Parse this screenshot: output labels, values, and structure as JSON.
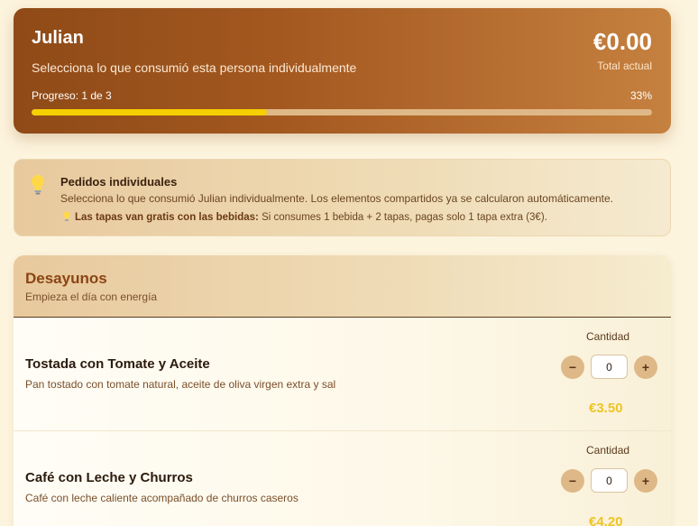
{
  "header": {
    "name": "Julian",
    "subtitle": "Selecciona lo que consumió esta persona individualmente",
    "total": "€0.00",
    "total_label": "Total actual",
    "progress_label": "Progreso: 1 de 3",
    "progress_percent_text": "33%",
    "progress_fraction": 0.38
  },
  "info": {
    "icon": "lightbulb-icon",
    "title": "Pedidos individuales",
    "description": "Selecciona lo que consumió Julian individualmente. Los elementos compartidos ya se calcularon automáticamente.",
    "tip_bold": "Las tapas van gratis con las bebidas:",
    "tip_text": " Si consumes 1 bebida + 2 tapas, pagas solo 1 tapa extra (3€)."
  },
  "section": {
    "title": "Desayunos",
    "subtitle": "Empieza el día con energía",
    "items": [
      {
        "name": "Tostada con Tomate y Aceite",
        "description": "Pan tostado con tomate natural, aceite de oliva virgen extra y sal",
        "quantity_label": "Cantidad",
        "quantity": "0",
        "price": "€3.50",
        "minus": "−",
        "plus": "+"
      },
      {
        "name": "Café con Leche y Churros",
        "description": "Café con leche caliente acompañado de churros caseros",
        "quantity_label": "Cantidad",
        "quantity": "0",
        "price": "€4.20",
        "minus": "−",
        "plus": "+"
      }
    ]
  },
  "colors": {
    "header_start": "#8f4a17",
    "header_end": "#c5813f",
    "progress_fill": "#f5cf00",
    "price": "#efc523",
    "section_title": "#8b4513",
    "stepper_button": "#deb887"
  }
}
